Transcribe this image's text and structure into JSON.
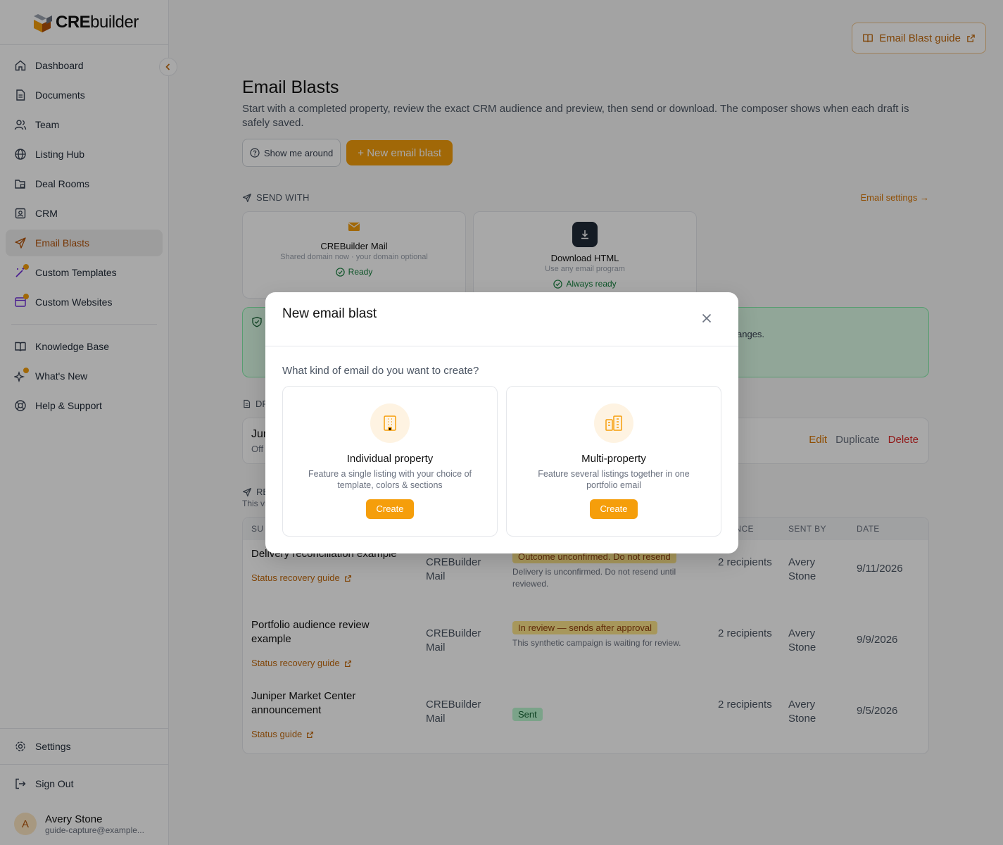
{
  "app": {
    "logo_bold": "CRE",
    "logo_light": "builder"
  },
  "colors": {
    "accent": "#f59e0b",
    "accent_text": "#d97706",
    "danger": "#dc2626",
    "success": "#15803d"
  },
  "sidebar": {
    "items": [
      {
        "label": "Dashboard",
        "icon": "home-icon"
      },
      {
        "label": "Documents",
        "icon": "document-icon"
      },
      {
        "label": "Team",
        "icon": "users-icon"
      },
      {
        "label": "Listing Hub",
        "icon": "globe-icon"
      },
      {
        "label": "Deal Rooms",
        "icon": "folder-lock-icon"
      },
      {
        "label": "CRM",
        "icon": "contact-card-icon"
      },
      {
        "label": "Email Blasts",
        "icon": "send-icon",
        "active": true
      },
      {
        "label": "Custom Templates",
        "icon": "magic-wand-icon"
      },
      {
        "label": "Custom Websites",
        "icon": "browser-icon"
      }
    ],
    "secondary": [
      {
        "label": "Knowledge Base",
        "icon": "book-icon"
      },
      {
        "label": "What's New",
        "icon": "sparkles-icon"
      },
      {
        "label": "Help & Support",
        "icon": "lifebuoy-icon"
      }
    ],
    "settings": "Settings",
    "signout": "Sign Out",
    "user": {
      "initial": "A",
      "name": "Avery Stone",
      "email": "guide-capture@example..."
    }
  },
  "header": {
    "guide_button": "Email Blast guide"
  },
  "page": {
    "title": "Email Blasts",
    "intro": "Start with a completed property, review the exact CRM audience and preview, then send or download. The composer shows when each draft is safely saved.",
    "tour_button": "Show me around",
    "new_button": "+ New email blast"
  },
  "send_with": {
    "label": "SEND WITH",
    "settings_link": "Email settings →",
    "cards": [
      {
        "title": "CREBuilder Mail",
        "subtitle": "Shared domain now · your domain optional",
        "status": "Ready"
      },
      {
        "title": "Download HTML",
        "subtitle": "Use any email program",
        "status": "Always ready"
      }
    ]
  },
  "notice": {
    "text_fragment": "anges."
  },
  "drafts": {
    "label_fragment": "DR",
    "row": {
      "name_fragment": "Jur",
      "sub_fragment": "Off",
      "edit": "Edit",
      "duplicate": "Duplicate",
      "delete": "Delete"
    }
  },
  "recent": {
    "label_fragment": "RE",
    "sub_fragment": "This vi",
    "headers": {
      "subject": "SU",
      "audience": "ENCE",
      "sent_by": "SENT BY",
      "date": "DATE"
    },
    "rows": [
      {
        "subject": "Delivery reconciliation example",
        "guide": "Status recovery guide",
        "service": "CREBuilder Mail",
        "badge": "Outcome unconfirmed. Do not resend",
        "badge_type": "warn",
        "note": "Delivery is unconfirmed. Do not resend until reviewed.",
        "audience": "2 recipients",
        "sent_by": "Avery Stone",
        "date": "9/11/2026"
      },
      {
        "subject": "Portfolio audience review example",
        "guide": "Status recovery guide",
        "service": "CREBuilder Mail",
        "badge": "In review — sends after approval",
        "badge_type": "warn",
        "note": "This synthetic campaign is waiting for review.",
        "audience": "2 recipients",
        "sent_by": "Avery Stone",
        "date": "9/9/2026"
      },
      {
        "subject": "Juniper Market Center announcement",
        "guide": "Status guide",
        "service": "CREBuilder Mail",
        "badge": "Sent",
        "badge_type": "sent",
        "note": "",
        "audience": "2 recipients",
        "sent_by": "Avery Stone",
        "date": "9/5/2026"
      }
    ]
  },
  "modal": {
    "title": "New email blast",
    "question": "What kind of email do you want to create?",
    "options": [
      {
        "title": "Individual property",
        "description": "Feature a single listing with your choice of template, colors & sections",
        "button": "Create",
        "icon": "building-icon"
      },
      {
        "title": "Multi-property",
        "description": "Feature several listings together in one portfolio email",
        "button": "Create",
        "icon": "buildings-icon"
      }
    ]
  }
}
